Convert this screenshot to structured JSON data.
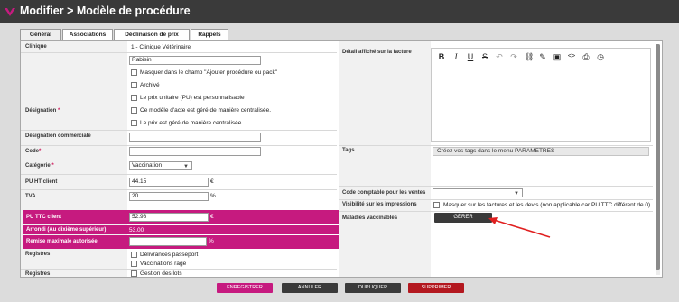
{
  "window": {
    "title": "Modifier > Modèle de procédure"
  },
  "tabs": [
    {
      "label": "Général",
      "active": true
    },
    {
      "label": "Associations",
      "active": false
    },
    {
      "label": "Déclinaison de prix",
      "active": false
    },
    {
      "label": "Rappels",
      "active": false
    }
  ],
  "form": {
    "clinique": {
      "label": "Clinique",
      "value": "1 - Clinique Vétérinaire"
    },
    "designation": {
      "label": "Désignation",
      "required_mark": "*",
      "value": "Rabisin",
      "options": [
        {
          "label": "Masquer dans le champ \"Ajouter procédure ou pack\"",
          "checked": false
        },
        {
          "label": "Archivé",
          "checked": false
        },
        {
          "label": "Le prix unitaire (PU) est personnalisable",
          "checked": false
        },
        {
          "label": "Ce modèle d'acte est géré de manière centralisée.",
          "checked": false
        },
        {
          "label": "Le prix est géré de manière centralisée.",
          "checked": false
        }
      ]
    },
    "designation_commerciale": {
      "label": "Désignation commerciale",
      "value": ""
    },
    "code": {
      "label": "Code",
      "required_mark": "*",
      "value": ""
    },
    "categorie": {
      "label": "Catégorie",
      "required_mark": "*",
      "value": "Vaccination"
    },
    "pu_ht": {
      "label": "PU HT client",
      "value": "44.15",
      "unit": "€"
    },
    "tva": {
      "label": "TVA",
      "value": "20",
      "unit": "%"
    },
    "pu_ttc": {
      "label": "PU TTC client",
      "value": "52.98",
      "unit": "€"
    },
    "arrondi": {
      "label": "Arrondi (Au dixième supérieur)",
      "value": "53.00"
    },
    "remise": {
      "label": "Remise maximale autorisée",
      "value": "",
      "unit": "%"
    },
    "registres": {
      "label": "Registres",
      "options": [
        {
          "label": "Délivrances passeport",
          "checked": false
        },
        {
          "label": "Vaccinations rage",
          "checked": false
        }
      ]
    },
    "registres2": {
      "label": "Registres",
      "options": [
        {
          "label": "Gestion des lots",
          "checked": false
        }
      ]
    }
  },
  "right": {
    "detail": {
      "label": "Détail affiché sur la facture"
    },
    "toolbar_icons": [
      "bold-icon",
      "italic-icon",
      "underline-icon",
      "strikethrough-icon",
      "undo-icon",
      "redo-icon",
      "link-icon",
      "edit-icon",
      "image-icon",
      "code-icon",
      "print-icon",
      "history-icon"
    ],
    "tags": {
      "label": "Tags",
      "value": "Créez vos tags dans le menu PARAMETRES"
    },
    "code_comptable": {
      "label": "Code comptable pour les ventes",
      "value": ""
    },
    "visibilite": {
      "label": "Visibilité sur les impressions",
      "option": "Masquer sur les factures et les devis (non applicable car PU TTC différent de 0)",
      "checked": false
    },
    "maladies": {
      "label": "Maladies vaccinables",
      "button": "GÉRER"
    }
  },
  "footer": {
    "save": "ENREGISTRER",
    "cancel": "ANNULER",
    "duplicate": "DUPLIQUER",
    "delete": "SUPPRIMER"
  },
  "colors": {
    "accent": "#c61a7f",
    "dark": "#3a3a3a",
    "danger": "#b3181f",
    "arrow": "#e02020"
  }
}
